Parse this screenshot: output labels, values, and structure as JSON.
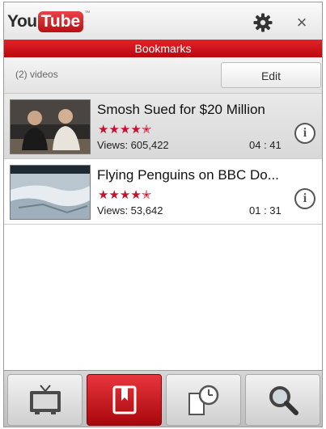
{
  "header": {
    "logo_you": "You",
    "logo_tube": "Tube",
    "logo_tm": "™",
    "settings_icon": "gear-icon",
    "close_icon": "close-icon",
    "close_glyph": "×"
  },
  "title_bar": {
    "title": "Bookmarks"
  },
  "list_header": {
    "count": "(2) videos",
    "edit_label": "Edit"
  },
  "videos": [
    {
      "title": "Smosh Sued for $20 Million",
      "rating_stars": "★★★★✭",
      "rating": 4.5,
      "views": "Views: 605,422",
      "duration": "04 : 41",
      "selected": true
    },
    {
      "title": "Flying Penguins on BBC Do...",
      "rating_stars": "★★★★✭",
      "rating": 4.5,
      "views": "Views: 53,642",
      "duration": "01 : 31",
      "selected": false
    }
  ],
  "info_glyph": "i",
  "tabs": [
    {
      "icon": "tv-icon",
      "active": false
    },
    {
      "icon": "bookmark-icon",
      "active": true
    },
    {
      "icon": "history-icon",
      "active": false
    },
    {
      "icon": "search-icon",
      "active": false
    }
  ],
  "colors": {
    "accent_red": "#c8102e",
    "title_bar_red": "#d1141b"
  }
}
